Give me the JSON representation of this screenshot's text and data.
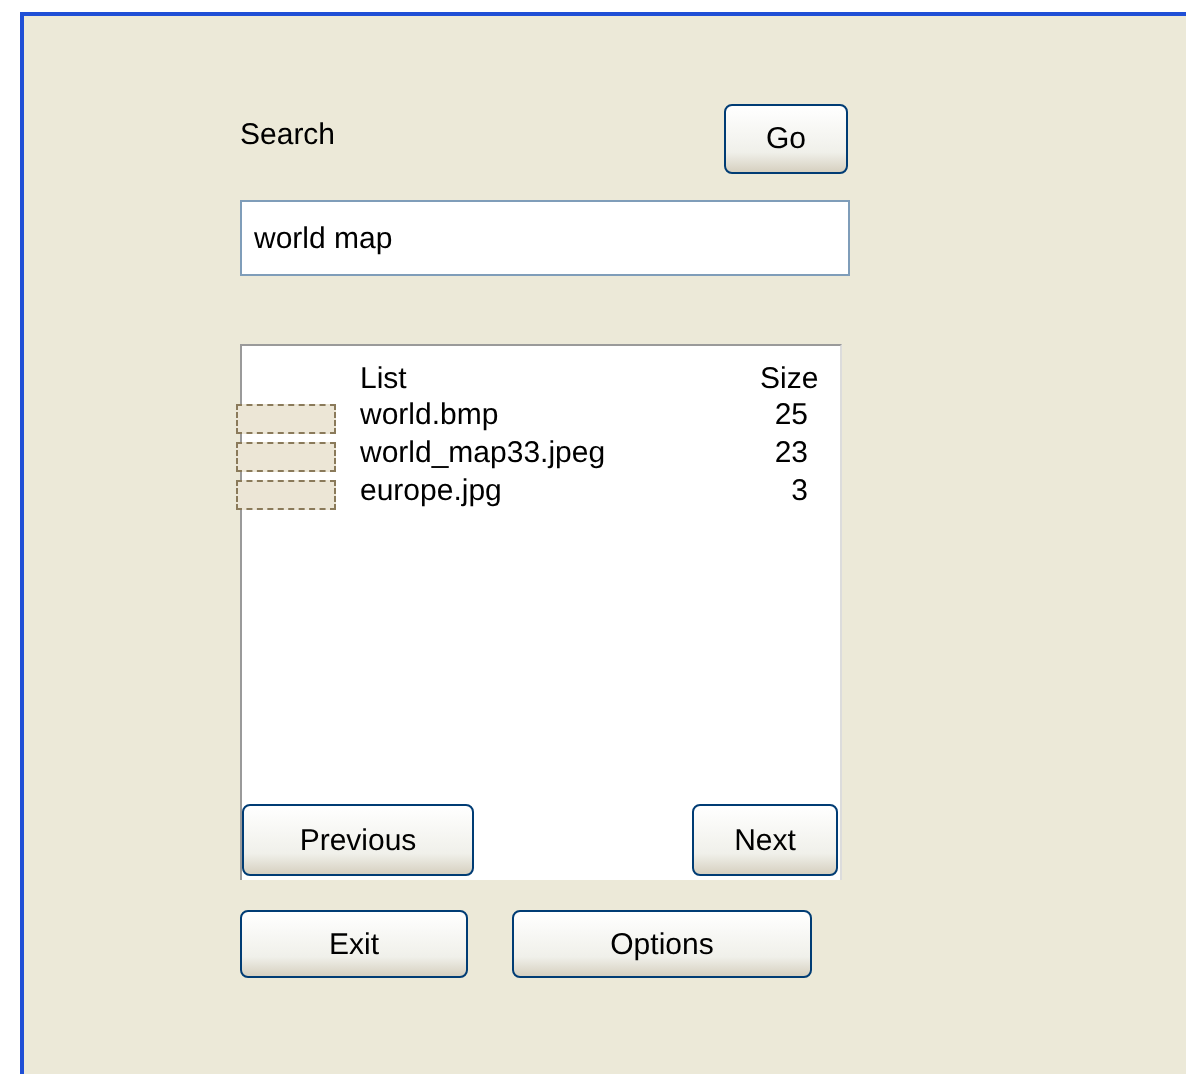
{
  "search": {
    "label": "Search",
    "go_button": "Go",
    "value": "world map"
  },
  "list": {
    "columns": [
      "List",
      "Size"
    ],
    "rows": [
      {
        "name": "world.bmp",
        "size": "25"
      },
      {
        "name": "world_map33.jpeg",
        "size": "23"
      },
      {
        "name": "europe.jpg",
        "size": "3"
      }
    ]
  },
  "pager": [
    "Previous",
    "Next"
  ],
  "buttons": [
    "Exit",
    "Options"
  ]
}
